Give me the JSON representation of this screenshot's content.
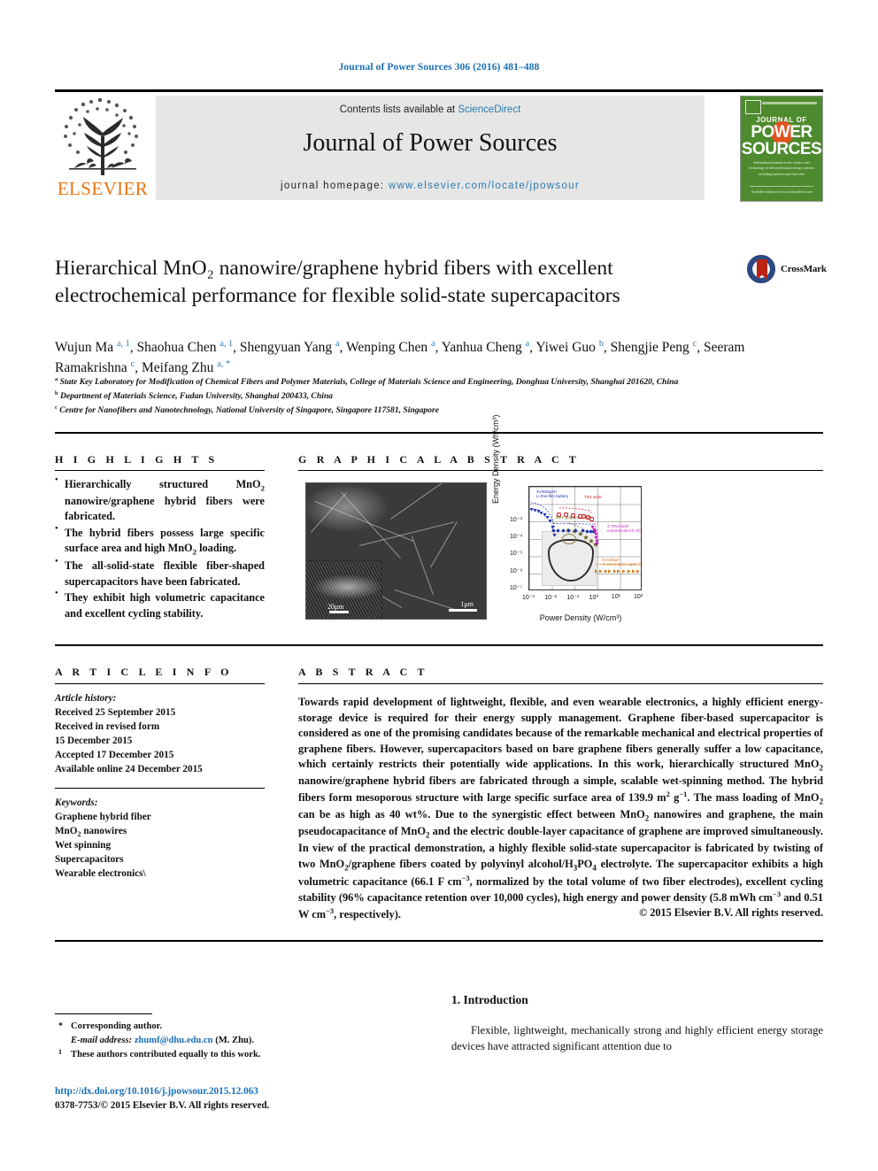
{
  "running_head": "Journal of Power Sources 306 (2016) 481–488",
  "masthead": {
    "contents_prefix": "Contents lists available at ",
    "sciencedirect": "ScienceDirect",
    "journal_name": "Journal of Power Sources",
    "homepage_prefix": "journal homepage: ",
    "homepage_url": "www.elsevier.com/locate/jpowsour",
    "publisher": "ELSEVIER",
    "cover": {
      "line1": "JOURNAL OF",
      "line2": "POWER",
      "line3": "SOURCES",
      "blurb": "International journal on the science and technology of electrochemical energy systems including batteries and fuel cells",
      "foot": "Available online at www.sciencedirect.com"
    }
  },
  "article": {
    "title": "Hierarchical MnO₂ nanowire/graphene hybrid fibers with excellent electrochemical performance for flexible solid-state supercapacitors",
    "crossmark_label": "CrossMark",
    "authors_html": "Wujun Ma <sup>a, 1</sup>, Shaohua Chen <sup>a, 1</sup>, Shengyuan Yang <sup>a</sup>, Wenping Chen <sup>a</sup>, Yanhua Cheng <sup>a</sup>, Yiwei Guo <sup>b</sup>, Shengjie Peng <sup>c</sup>, Seeram Ramakrishna <sup>c</sup>, Meifang Zhu <sup>a, *</sup>",
    "affiliations": [
      {
        "marker": "a",
        "text": "State Key Laboratory for Modification of Chemical Fibers and Polymer Materials, College of Materials Science and Engineering, Donghua University, Shanghai 201620, China"
      },
      {
        "marker": "b",
        "text": "Department of Materials Science, Fudan University, Shanghai 200433, China"
      },
      {
        "marker": "c",
        "text": "Centre for Nanofibers and Nanotechnology, National University of Singapore, Singapore 117581, Singapore"
      }
    ]
  },
  "highlights": {
    "heading": "H I G H L I G H T S",
    "items_html": [
      "Hierarchically structured MnO<sub>2</sub> nanowire/graphene hybrid fibers were fabricated.",
      "The hybrid fibers possess large specific surface area and high MnO<sub>2</sub> loading.",
      "The all-solid-state flexible fiber-shaped supercapacitors have been fabricated.",
      "They exhibit high volumetric capacitance and excellent cycling stability."
    ]
  },
  "graphical_abstract": {
    "heading": "G R A P H I C A L   A B S T R A C T",
    "sem_image": {
      "scalebar_main": "1μm",
      "scalebar_inset": "20μm"
    }
  },
  "chart_data": {
    "type": "scatter",
    "title": "",
    "xlabel": "Power Density (W/cm³)",
    "ylabel": "Energy Density (Wh/cm³)",
    "xlim": [
      0.001,
      100
    ],
    "ylim": [
      1e-07,
      0.1
    ],
    "xscale": "log",
    "yscale": "log",
    "xticks": [
      "10⁻³",
      "10⁻²",
      "10⁻¹",
      "10⁰",
      "10¹",
      "10²"
    ],
    "yticks": [
      "10⁻³",
      "10⁻⁴",
      "10⁻⁵",
      "10⁻⁶",
      "10⁻⁷"
    ],
    "grid": true,
    "legend_position": "inline-annotations",
    "annotations": [
      {
        "text": "4V/500μAh Li thin-film battery",
        "color": "#1b2fb0"
      },
      {
        "text": "This work",
        "color": "#d0161c"
      },
      {
        "text": "bare graphene fiber",
        "color": "#6d6a1f"
      },
      {
        "text": "3.5V/100mF commercial SC",
        "color": "#1b2fb0"
      },
      {
        "text": "2.75V/44mF commercial AC-SC",
        "color": "#c51bbb"
      },
      {
        "text": "3V/300μF Al electrolytic capacitor",
        "color": "#cf7a18"
      }
    ],
    "series": [
      {
        "name": "4V/500μAh Li thin-film battery",
        "color": "#1b2fb0",
        "marker": "triangle-down",
        "x": [
          0.0012,
          0.0018,
          0.0025,
          0.0035,
          0.0048,
          0.0065,
          0.0085,
          0.011,
          0.014
        ],
        "y": [
          0.012,
          0.011,
          0.0095,
          0.008,
          0.006,
          0.0042,
          0.0025,
          0.0012,
          0.0004
        ]
      },
      {
        "name": "This work",
        "color": "#d0161c",
        "marker": "circle",
        "x": [
          0.022,
          0.045,
          0.09,
          0.2,
          0.28,
          0.45,
          0.62
        ],
        "y": [
          0.0058,
          0.0058,
          0.0054,
          0.005,
          0.0046,
          0.0042,
          0.0032
        ]
      },
      {
        "name": "bare graphene fiber",
        "color": "#6d6a1f",
        "marker": "star",
        "x": [
          0.055,
          0.1,
          0.2,
          0.32,
          0.55,
          0.9
        ],
        "y": [
          0.00075,
          0.00062,
          0.00042,
          0.00028,
          0.00018,
          0.00011
        ]
      },
      {
        "name": "3.5V/100mF commercial SC",
        "color": "#1b2fb0",
        "marker": "diamond",
        "x": [
          0.012,
          0.02,
          0.035,
          0.06,
          0.12,
          0.25,
          0.4,
          0.55,
          0.75
        ],
        "y": [
          0.00072,
          0.00072,
          0.0007,
          0.0007,
          0.00068,
          0.00068,
          0.00066,
          0.00066,
          0.00064
        ]
      },
      {
        "name": "2.75V/44mF commercial AC-SC",
        "color": "#c51bbb",
        "marker": "triangle-down",
        "x": [
          0.7,
          0.8,
          0.88,
          0.95,
          1.0,
          1.05,
          1.1
        ],
        "y": [
          0.0011,
          0.00085,
          0.00062,
          0.00042,
          0.00028,
          0.00018,
          0.00012
        ]
      },
      {
        "name": "3V/300μF Al electrolytic capacitor",
        "color": "#cf7a18",
        "marker": "triangle-right",
        "x": [
          1.0,
          1.6,
          2.6,
          4.0,
          6.5,
          10,
          17,
          28,
          45,
          70
        ],
        "y": [
          3e-06,
          3e-06,
          3e-06,
          3e-06,
          3e-06,
          3e-06,
          3e-06,
          3e-06,
          3e-06,
          3e-06
        ]
      }
    ]
  },
  "article_info": {
    "heading": "A R T I C L E   I N F O",
    "history_label": "Article history:",
    "history": [
      "Received 25 September 2015",
      "Received in revised form",
      "15 December 2015",
      "Accepted 17 December 2015",
      "Available online 24 December 2015"
    ],
    "keywords_label": "Keywords:",
    "keywords_html": [
      "Graphene hybrid fiber",
      "MnO<sub>2</sub> nanowires",
      "Wet spinning",
      "Supercapacitors",
      "Wearable electronics\\"
    ]
  },
  "abstract": {
    "heading": "A B S T R A C T",
    "body_html": "Towards rapid development of lightweight, flexible, and even wearable electronics, a highly efficient energy-storage device is required for their energy supply management. Graphene fiber-based supercapacitor is considered as one of the promising candidates because of the remarkable mechanical and electrical properties of graphene fibers. However, supercapacitors based on bare graphene fibers generally suffer a low capacitance, which certainly restricts their potentially wide applications. In this work, hierarchically structured MnO<sub>2</sub> nanowire/graphene hybrid fibers are fabricated through a simple, scalable wet-spinning method. The hybrid fibers form mesoporous structure with large specific surface area of 139.9 m<sup>2</sup> g<sup>−1</sup>. The mass loading of MnO<sub>2</sub> can be as high as 40 wt%. Due to the synergistic effect between MnO<sub>2</sub> nanowires and graphene, the main pseudocapacitance of MnO<sub>2</sub> and the electric double-layer capacitance of graphene are improved simultaneously. In view of the practical demonstration, a highly flexible solid-state supercapacitor is fabricated by twisting of two MnO<sub>2</sub>/graphene fibers coated by polyvinyl alcohol/H<sub>3</sub>PO<sub>4</sub> electrolyte. The supercapacitor exhibits a high volumetric capacitance (66.1 F cm<sup>−3</sup>, normalized by the total volume of two fiber electrodes), excellent cycling stability (96% capacitance retention over 10,000 cycles), high energy and power density (5.8 mWh cm<sup>−3</sup> and 0.51 W cm<sup>−3</sup>, respectively).",
    "copyright": "© 2015 Elsevier B.V. All rights reserved."
  },
  "introduction": {
    "heading": "1.  Introduction",
    "body": "Flexible, lightweight, mechanically strong and highly efficient energy storage devices have attracted significant attention due to"
  },
  "footnotes": {
    "corresponding_marker": "*",
    "corresponding_text": "Corresponding author.",
    "email_label": "E-mail address:",
    "email": "zhumf@dhu.edu.cn",
    "email_suffix": "(M. Zhu).",
    "equal_marker": "1",
    "equal_text": "These authors contributed equally to this work.",
    "doi": "http://dx.doi.org/10.1016/j.jpowsour.2015.12.063",
    "issn_line": "0378-7753/© 2015 Elsevier B.V. All rights reserved."
  },
  "colors": {
    "link": "#1a6fb5",
    "elsevier_orange": "#E87511",
    "cover_green": "#4e8b2e"
  }
}
